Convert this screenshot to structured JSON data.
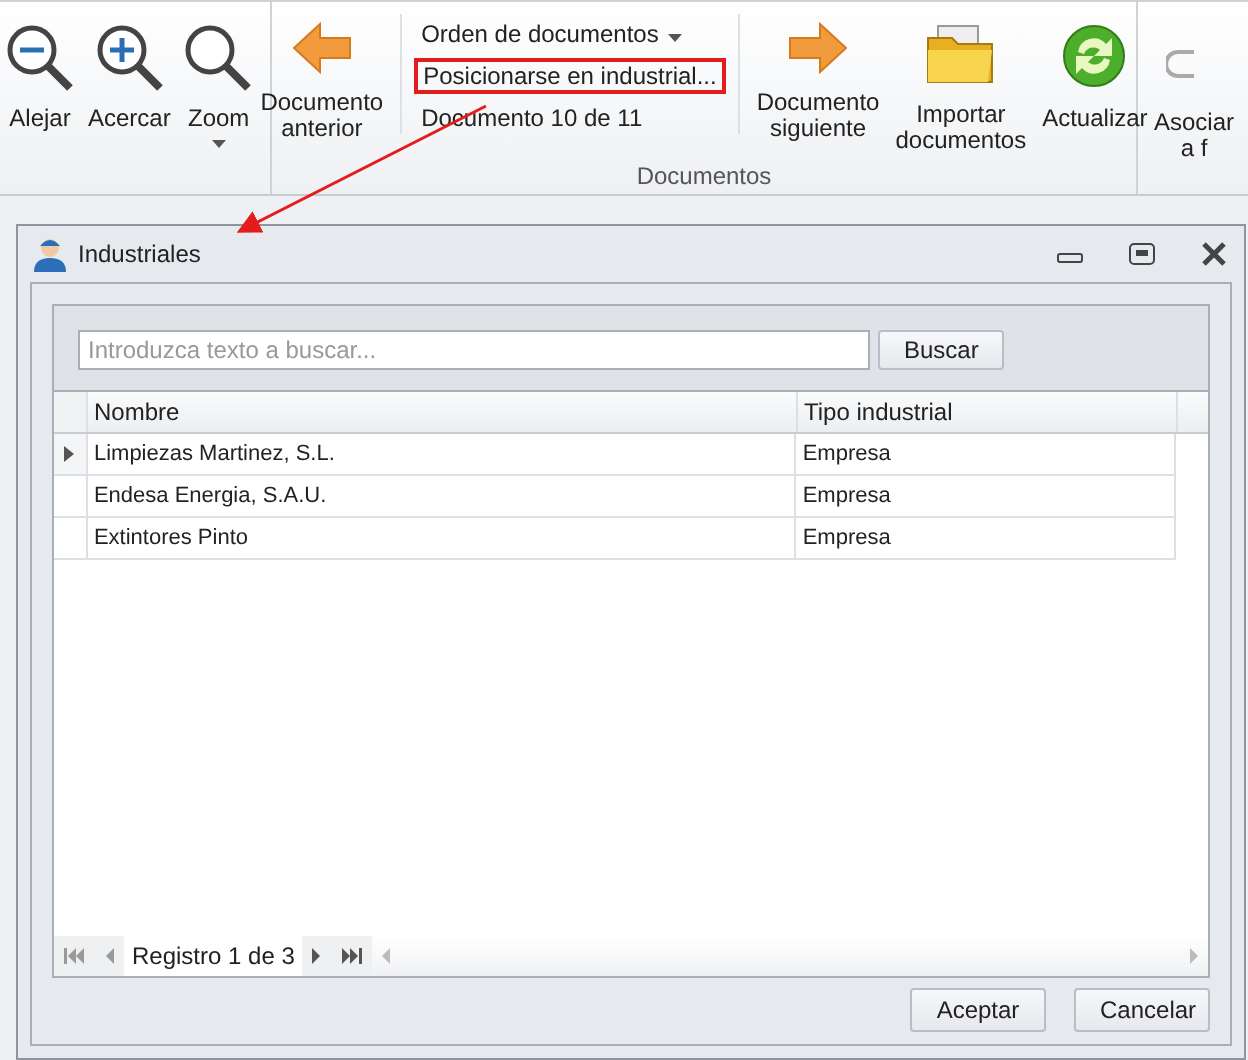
{
  "ribbon": {
    "zoom_group": [
      {
        "label": "Alejar",
        "dropdown": false
      },
      {
        "label": "Acercar",
        "dropdown": false
      },
      {
        "label": "Zoom",
        "dropdown": true
      }
    ],
    "documents_group": {
      "label": "Documentos",
      "previous": "Documento\nanterior",
      "order": "Orden de documentos",
      "locate": "Posicionarse en industrial...",
      "position": "Documento 10 de 11",
      "next": "Documento\nsiguiente"
    },
    "extra": [
      "Importar\ndocumentos",
      "Actualizar"
    ],
    "cut_button": "Asociar\na f"
  },
  "dialog": {
    "title": "Industriales",
    "search": {
      "placeholder": "Introduzca texto a buscar...",
      "button": "Buscar"
    },
    "table": {
      "columns": [
        "Nombre",
        "Tipo industrial"
      ],
      "rows": [
        {
          "cells": [
            "Limpiezas Martinez, S.L.",
            "Empresa"
          ],
          "selected": true
        },
        {
          "cells": [
            "Endesa Energia, S.A.U.",
            "Empresa"
          ],
          "selected": false
        },
        {
          "cells": [
            "Extintores Pinto",
            "Empresa"
          ],
          "selected": false
        }
      ]
    },
    "navigator": "Registro 1 de 3",
    "buttons": [
      "Aceptar",
      "Cancelar"
    ]
  }
}
